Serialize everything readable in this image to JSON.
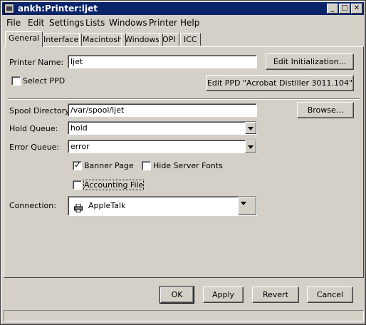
{
  "window": {
    "title": "ankh:Printer:ljet"
  },
  "menu": [
    "File",
    "Edit",
    "Settings",
    "Lists",
    "Windows",
    "Printer",
    "Help"
  ],
  "tabs": [
    "General",
    "Interface",
    "Macintosh",
    "Windows",
    "OPI",
    "ICC"
  ],
  "form": {
    "printer_name_label": "Printer Name:",
    "printer_name_value": "ljet",
    "edit_init_button": "Edit Initialization...",
    "select_ppd_label": "Select PPD",
    "select_ppd_checked": false,
    "edit_ppd_button": "Edit PPD \"Acrobat Distiller 3011.104\"",
    "spool_label": "Spool Directory:",
    "spool_value": "/var/spool/ljet",
    "browse_button": "Browse...",
    "hold_label": "Hold Queue:",
    "hold_value": "hold",
    "error_label": "Error Queue:",
    "error_value": "error",
    "banner_label": "Banner Page",
    "banner_checked": true,
    "hide_fonts_label": "Hide Server Fonts",
    "hide_fonts_checked": false,
    "accounting_label": "Accounting File",
    "accounting_checked": false,
    "connection_label": "Connection:",
    "connection_value": "AppleTalk"
  },
  "footer": {
    "ok": "OK",
    "apply": "Apply",
    "revert": "Revert",
    "cancel": "Cancel"
  },
  "colors": {
    "titlebar": "#0a246a",
    "face": "#d4d0c8"
  }
}
